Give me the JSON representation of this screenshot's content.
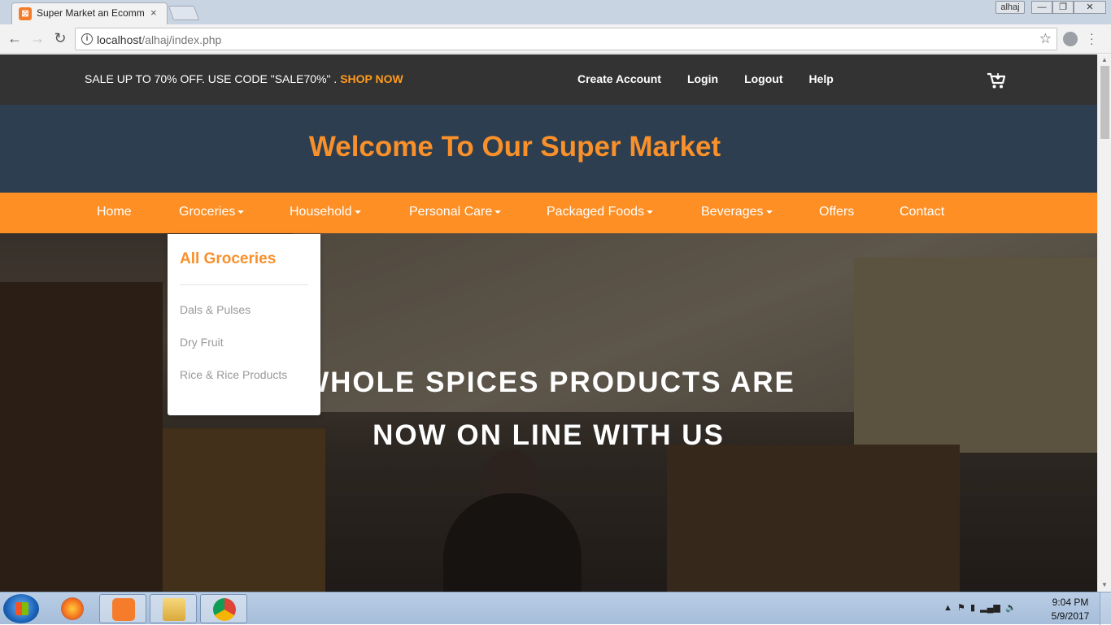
{
  "browser": {
    "tab_title": "Super Market an Ecommerce",
    "tab_close": "×",
    "user_badge": "alhaj",
    "url_host": "localhost",
    "url_path": "/alhaj/index.php",
    "window_controls": {
      "minimize": "—",
      "maximize": "❐",
      "close": "✕"
    }
  },
  "topbar": {
    "promo_text": "SALE UP TO 70% OFF. USE CODE \"SALE70%\" . ",
    "promo_link": "SHOP NOW",
    "links": [
      "Create Account",
      "Login",
      "Logout",
      "Help"
    ],
    "cart_icon": "cart-icon"
  },
  "header": {
    "title": "Welcome To Our Super Market"
  },
  "nav": {
    "items": [
      {
        "label": "Home",
        "dropdown": false
      },
      {
        "label": "Groceries",
        "dropdown": true
      },
      {
        "label": "Household",
        "dropdown": true
      },
      {
        "label": "Personal Care",
        "dropdown": true
      },
      {
        "label": "Packaged Foods",
        "dropdown": true
      },
      {
        "label": "Beverages",
        "dropdown": true
      },
      {
        "label": "Offers",
        "dropdown": false
      },
      {
        "label": "Contact",
        "dropdown": false
      }
    ]
  },
  "dropdown": {
    "title": "All Groceries",
    "items": [
      "Dals & Pulses",
      "Dry Fruit",
      "Rice & Rice Products"
    ]
  },
  "hero": {
    "line1": "WHOLE SPICES PRODUCTS ARE",
    "line2": "NOW ON LINE WITH US"
  },
  "taskbar": {
    "time": "9:04 PM",
    "date": "5/9/2017"
  },
  "colors": {
    "accent_orange": "#fd8f25",
    "title_orange": "#f9902a",
    "topbar_bg": "#333333",
    "header_bg": "#2c3e50"
  }
}
